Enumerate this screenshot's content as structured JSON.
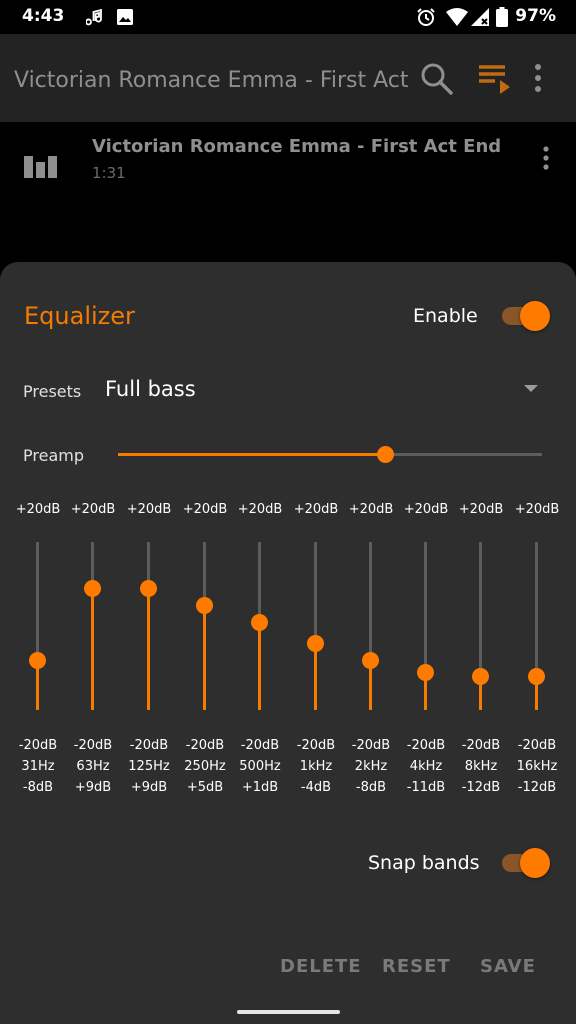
{
  "status_bar": {
    "time": "4:43",
    "battery": "97%"
  },
  "toolbar": {
    "title": "Victorian Romance Emma - First Act En",
    "search_icon": "search-icon",
    "queue_icon": "playlist-play-icon",
    "more_icon": "more-vert-icon",
    "accent": "#f57c00"
  },
  "now_playing": {
    "title": "Victorian Romance Emma - First Act Endin…",
    "duration": "1:31"
  },
  "equalizer": {
    "title": "Equalizer",
    "enable_label": "Enable",
    "enabled": true,
    "presets_label": "Presets",
    "preset_value": "Full bass",
    "preamp_label": "Preamp",
    "preamp_level": 0.63,
    "bands": [
      {
        "top": "+20dB",
        "bottom": "-20dB",
        "freq": "31Hz",
        "gain": "-8dB",
        "gain_db": -8
      },
      {
        "top": "+20dB",
        "bottom": "-20dB",
        "freq": "63Hz",
        "gain": "+9dB",
        "gain_db": 9
      },
      {
        "top": "+20dB",
        "bottom": "-20dB",
        "freq": "125Hz",
        "gain": "+9dB",
        "gain_db": 9
      },
      {
        "top": "+20dB",
        "bottom": "-20dB",
        "freq": "250Hz",
        "gain": "+5dB",
        "gain_db": 5
      },
      {
        "top": "+20dB",
        "bottom": "-20dB",
        "freq": "500Hz",
        "gain": "+1dB",
        "gain_db": 1
      },
      {
        "top": "+20dB",
        "bottom": "-20dB",
        "freq": "1kHz",
        "gain": "-4dB",
        "gain_db": -4
      },
      {
        "top": "+20dB",
        "bottom": "-20dB",
        "freq": "2kHz",
        "gain": "-8dB",
        "gain_db": -8
      },
      {
        "top": "+20dB",
        "bottom": "-20dB",
        "freq": "4kHz",
        "gain": "-11dB",
        "gain_db": -11
      },
      {
        "top": "+20dB",
        "bottom": "-20dB",
        "freq": "8kHz",
        "gain": "-12dB",
        "gain_db": -12
      },
      {
        "top": "+20dB",
        "bottom": "-20dB",
        "freq": "16kHz",
        "gain": "-12dB",
        "gain_db": -12
      }
    ],
    "snap_label": "Snap bands",
    "snap_enabled": true,
    "actions": {
      "delete": "DELETE",
      "reset": "RESET",
      "save": "SAVE"
    }
  }
}
